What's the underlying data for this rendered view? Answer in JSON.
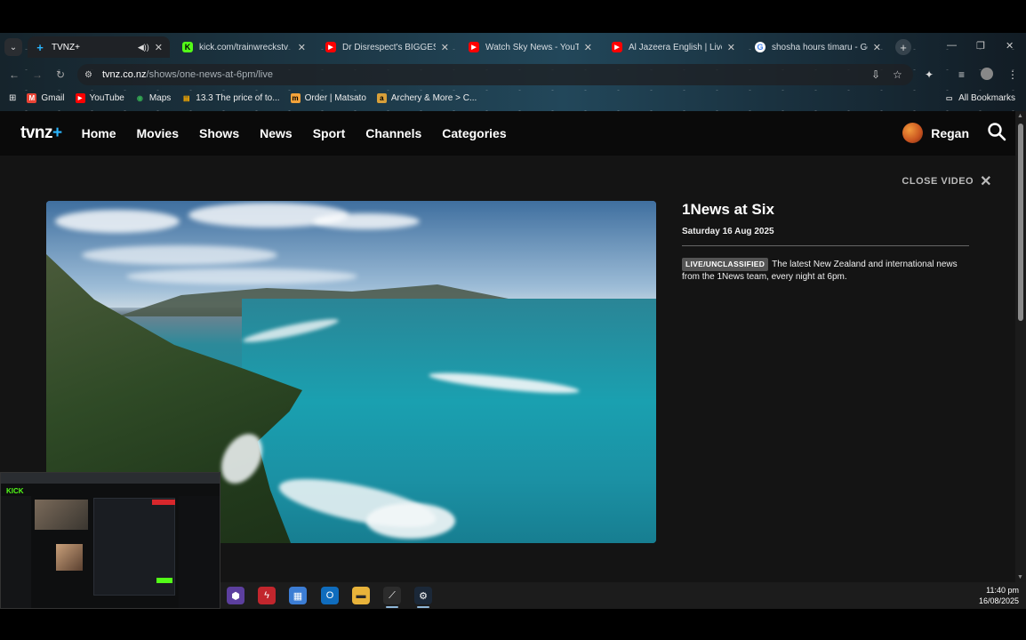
{
  "browser": {
    "tabs": [
      {
        "title": "TVNZ+",
        "favicon": "tvnz-plus-icon",
        "active": true,
        "audio": true
      },
      {
        "title": "kick.com/trainwreckstv",
        "favicon": "kick-icon",
        "active": false
      },
      {
        "title": "Dr Disrespect's BIGGEST A...",
        "favicon": "youtube-icon",
        "active": false
      },
      {
        "title": "Watch Sky News - YouTube",
        "favicon": "youtube-icon",
        "active": false
      },
      {
        "title": "Al Jazeera English | Live",
        "favicon": "youtube-icon",
        "active": false
      },
      {
        "title": "shosha hours timaru - Goog...",
        "favicon": "google-icon",
        "active": false
      }
    ],
    "address": {
      "host": "tvnz.co.nz",
      "path": "/shows/one-news-at-6pm/live"
    },
    "bookmarks": [
      {
        "label": "Gmail",
        "icon": "gmail-icon",
        "color": "#ea4335"
      },
      {
        "label": "YouTube",
        "icon": "youtube-icon",
        "color": "#ff0000"
      },
      {
        "label": "Maps",
        "icon": "maps-icon",
        "color": "#34a853"
      },
      {
        "label": "13.3 The price of to...",
        "icon": "page-icon",
        "color": "#f9ab00"
      },
      {
        "label": "Order | Matsato",
        "icon": "matsato-icon",
        "color": "#f2a23a"
      },
      {
        "label": "Archery & More > C...",
        "icon": "archery-icon",
        "color": "#d8a03a"
      }
    ],
    "all_bookmarks": "All Bookmarks"
  },
  "site": {
    "logo": {
      "text": "tvnz",
      "plus": "+"
    },
    "nav": [
      "Home",
      "Movies",
      "Shows",
      "News",
      "Sport",
      "Channels",
      "Categories"
    ],
    "user": "Regan",
    "close_video": "CLOSE VIDEO",
    "show": {
      "title": "1News at Six",
      "date": "Saturday 16 Aug 2025",
      "badge": "LIVE/UNCLASSIFIED",
      "description": "The latest New Zealand and international news from the 1News team, every night at 6pm."
    }
  },
  "taskbar": {
    "apps": [
      "app-purple-icon",
      "app-red-bolt-icon",
      "store-icon",
      "outlook-icon",
      "file-explorer-icon",
      "app-blade-icon",
      "steam-icon"
    ],
    "time": "11:40 pm",
    "date": "16/08/2025"
  },
  "colors": {
    "accent": "#2ab6ff",
    "kick": "#53fc18",
    "page_bg": "#141414"
  }
}
